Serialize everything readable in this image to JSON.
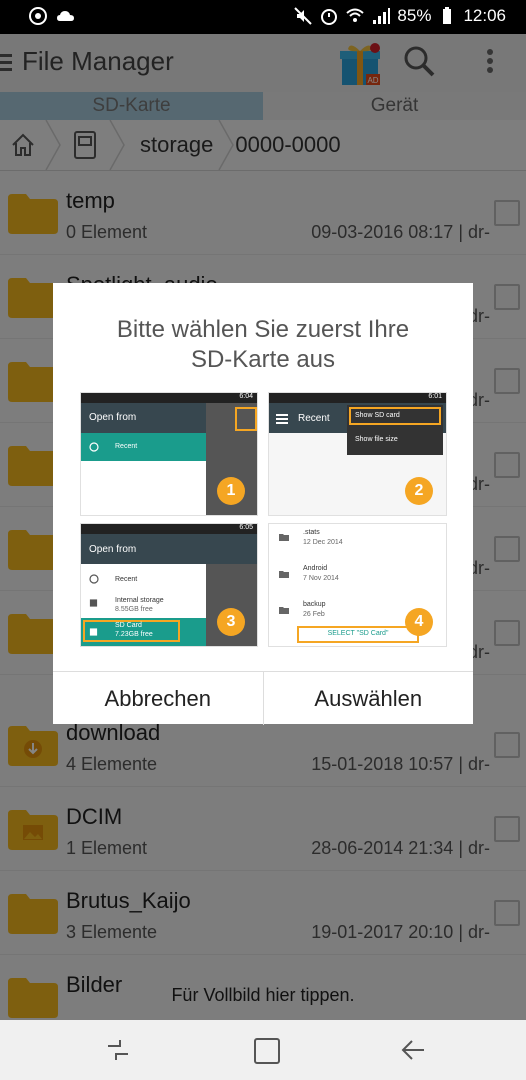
{
  "status_bar": {
    "battery": "85%",
    "time": "12:06"
  },
  "app_bar": {
    "title": "File Manager",
    "gift_badge": "AD"
  },
  "tabs": [
    {
      "label": "SD-Karte",
      "active": true
    },
    {
      "label": "Gerät",
      "active": false
    }
  ],
  "breadcrumb": {
    "items": [
      "storage",
      "0000-0000"
    ]
  },
  "files": [
    {
      "name": "temp",
      "count": "0 Element",
      "date": "09-03-2016 08:17 | dr-"
    },
    {
      "name": "Spotlight_audio",
      "count": "",
      "date": "dr-"
    },
    {
      "name": "",
      "count": "",
      "date": "dr-"
    },
    {
      "name": "",
      "count": "",
      "date": "dr-"
    },
    {
      "name": "",
      "count": "",
      "date": "dr-"
    },
    {
      "name": "",
      "count": "",
      "date": "dr-"
    },
    {
      "name": "download",
      "count": "4 Elemente",
      "date": "15-01-2018 10:57 | dr-"
    },
    {
      "name": "DCIM",
      "count": "1 Element",
      "date": "28-06-2014 21:34 | dr-"
    },
    {
      "name": "Brutus_Kaijo",
      "count": "3 Elemente",
      "date": "19-01-2017 20:10 | dr-"
    },
    {
      "name": "Bilder",
      "count": "",
      "date": ""
    }
  ],
  "dialog": {
    "title_line1": "Bitte wählen Sie zuerst Ihre",
    "title_line2": "SD-Karte aus",
    "cancel_label": "Abbrechen",
    "confirm_label": "Auswählen",
    "step1": {
      "header": "Open from",
      "item": "Recent",
      "badge": "1",
      "time": "6:04"
    },
    "step2": {
      "header": "Recent",
      "menu1": "Show SD card",
      "menu2": "Show file size",
      "badge": "2",
      "time": "6:01"
    },
    "step3": {
      "header": "Open from",
      "item1": "Recent",
      "item2": "Internal storage",
      "item2_sub": "8.55GB free",
      "item3": "SD Card",
      "item3_sub": "7.23GB free",
      "badge": "3",
      "time": "6:05"
    },
    "step4": {
      "rows": [
        {
          "name": ".stats",
          "date": "12 Dec 2014"
        },
        {
          "name": "Android",
          "date": "7 Nov 2014"
        },
        {
          "name": "backup",
          "date": "26 Feb"
        }
      ],
      "button": "SELECT \"SD Card\"",
      "badge": "4"
    }
  },
  "toast": "Für Vollbild hier tippen.",
  "colors": {
    "accent_teal": "#1a9c8c",
    "badge_orange": "#f5a623",
    "tab_active": "#a6c8d8"
  }
}
